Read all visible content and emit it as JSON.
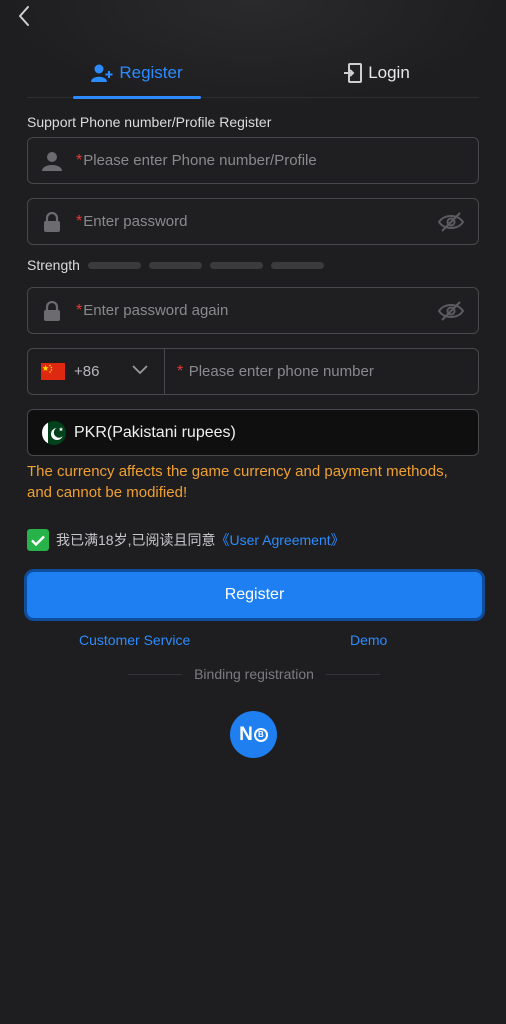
{
  "tabs": {
    "register": "Register",
    "login": "Login"
  },
  "form": {
    "support_label": "Support Phone number/Profile Register",
    "account_placeholder": "Please enter Phone number/Profile",
    "password_placeholder": "Enter password",
    "strength_label": "Strength",
    "strength_level": 0,
    "confirm_placeholder": "Enter password again",
    "country_code": "+86",
    "phone_placeholder": "Please enter phone number",
    "currency": "PKR(Pakistani rupees)",
    "currency_warning": "The currency affects the game currency and payment methods, and cannot be modified!",
    "agreement_text": "我已满18岁,已阅读且同意",
    "agreement_link": "《User Agreement》",
    "agreement_checked": true,
    "required_mark": "*"
  },
  "actions": {
    "register_button": "Register",
    "customer_service": "Customer Service",
    "demo": "Demo",
    "binding_registration": "Binding registration"
  },
  "logo": {
    "text": "N",
    "coin": "B"
  },
  "colors": {
    "accent": "#2c8cff",
    "required": "#e53a3a",
    "warning": "#f0a030",
    "checkbox": "#27b24a",
    "button": "#1e7ff2"
  },
  "icons": [
    "back-arrow-icon",
    "add-user-icon",
    "login-door-icon",
    "user-icon",
    "lock-icon",
    "eye-off-icon",
    "china-flag-icon",
    "chevron-down-icon",
    "pakistan-flag-icon",
    "check-icon"
  ]
}
